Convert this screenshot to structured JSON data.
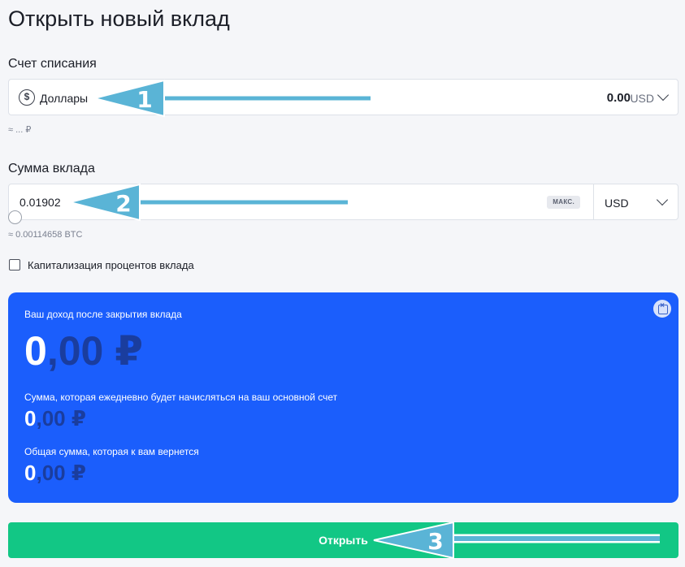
{
  "page": {
    "title": "Открыть новый вклад"
  },
  "account": {
    "label": "Счет списания",
    "icon": "dollar-circle-icon",
    "name": "Доллары",
    "balance": "0.00",
    "currency": "USD",
    "hint": "≈ ... ₽"
  },
  "deposit": {
    "label": "Сумма вклада",
    "value": "0.01902",
    "max_label": "МАКС.",
    "currency": "USD",
    "hint": "≈ 0.00114658 BTC"
  },
  "capitalization": {
    "label": "Капитализация процентов вклада",
    "checked": false
  },
  "income": {
    "title": "Ваш доход после закрытия вклада",
    "total_int": "0",
    "total_frac": ",00 ₽",
    "daily_label": "Сумма, которая ежедневно будет начисляться на ваш основной счет",
    "daily_int": "0",
    "daily_frac": ",00 ₽",
    "return_label": "Общая сумма, которая к вам вернется",
    "return_int": "0",
    "return_frac": ",00 ₽"
  },
  "submit": {
    "label": "Открыть"
  },
  "annotations": [
    {
      "number": "1",
      "color": "#5ab4d6"
    },
    {
      "number": "2",
      "color": "#5ab4d6"
    },
    {
      "number": "3",
      "color": "#5ab4d6"
    }
  ],
  "colors": {
    "card": "#1b5efc",
    "button": "#12c785",
    "background": "#f5f6f9"
  }
}
